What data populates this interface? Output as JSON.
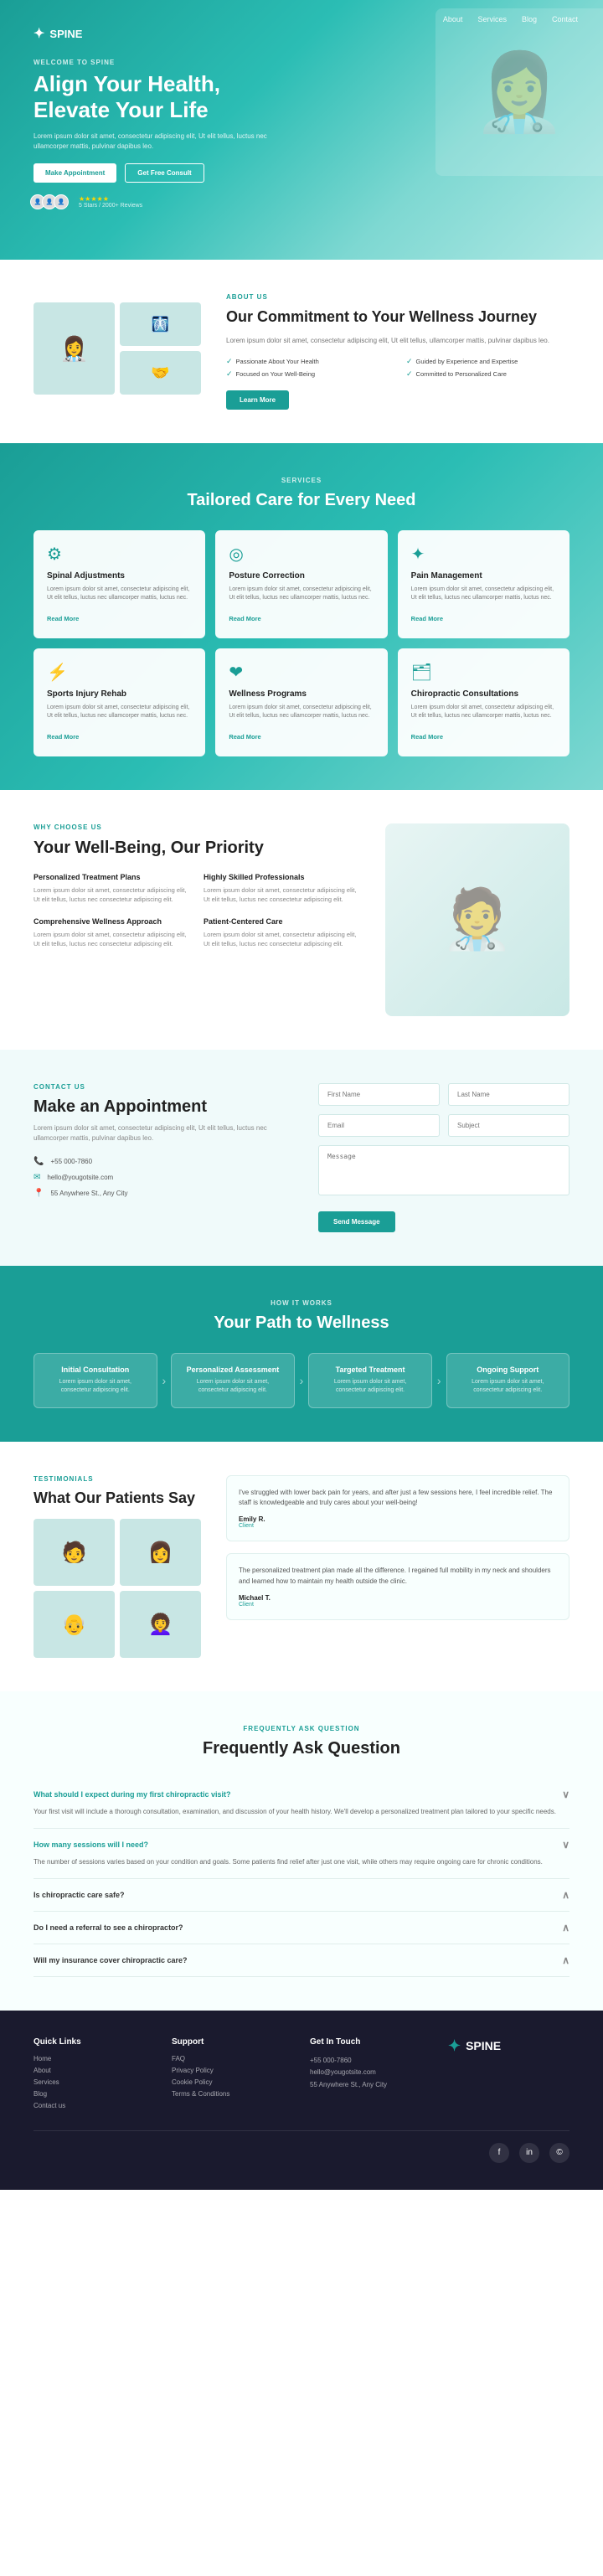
{
  "brand": {
    "name": "SPINE",
    "logo_symbol": "✦"
  },
  "nav": {
    "items": [
      "About",
      "Services",
      "Blog",
      "Contact"
    ]
  },
  "hero": {
    "welcome": "WELCOME TO SPINE",
    "headline": "Align Your Health, Elevate Your Life",
    "description": "Lorem ipsum dolor sit amet, consectetur adipiscing elit, Ut elit tellus, luctus nec ullamcorper mattis, pulvinar dapibus leo.",
    "btn_appointment": "Make Appointment",
    "btn_consult": "Get Free Consult",
    "rating": "★★★★★",
    "rating_text": "5 Stars / 2000+ Reviews"
  },
  "commitment": {
    "label": "ABOUT US",
    "heading": "Our Commitment to Your Wellness Journey",
    "description": "Lorem ipsum dolor sit amet, consectetur adipiscing elit, Ut elit tellus, ullamcorper mattis, pulvinar dapibus leo.",
    "features": [
      "Passionate About Your Health",
      "Guided by Experience and Expertise",
      "Focused on Your Well-Being",
      "Committed to Personalized Care"
    ],
    "btn_learn": "Learn More"
  },
  "services": {
    "label": "SERVICES",
    "heading": "Tailored Care for Every Need",
    "items": [
      {
        "icon": "⚙",
        "title": "Spinal Adjustments",
        "description": "Lorem ipsum dolor sit amet, consectetur adipiscing elit, Ut elit tellus, luctus nec ullamcorper mattis, luctus nec.",
        "link": "Read More"
      },
      {
        "icon": "◎",
        "title": "Posture Correction",
        "description": "Lorem ipsum dolor sit amet, consectetur adipiscing elit, Ut elit tellus, luctus nec ullamcorper mattis, luctus nec.",
        "link": "Read More"
      },
      {
        "icon": "✦",
        "title": "Pain Management",
        "description": "Lorem ipsum dolor sit amet, consectetur adipiscing elit, Ut elit tellus, luctus nec ullamcorper mattis, luctus nec.",
        "link": "Read More"
      },
      {
        "icon": "⚡",
        "title": "Sports Injury Rehab",
        "description": "Lorem ipsum dolor sit amet, consectetur adipiscing elit, Ut elit tellus, luctus nec ullamcorper mattis, luctus nec.",
        "link": "Read More"
      },
      {
        "icon": "❤",
        "title": "Wellness Programs",
        "description": "Lorem ipsum dolor sit amet, consectetur adipiscing elit, Ut elit tellus, luctus nec ullamcorper mattis, luctus nec.",
        "link": "Read More"
      },
      {
        "icon": "🗂",
        "title": "Chiropractic Consultations",
        "description": "Lorem ipsum dolor sit amet, consectetur adipiscing elit, Ut elit tellus, luctus nec ullamcorper mattis, luctus nec.",
        "link": "Read More"
      }
    ]
  },
  "why": {
    "label": "WHY CHOOSE US",
    "heading": "Your Well-Being, Our Priority",
    "items": [
      {
        "title": "Personalized Treatment Plans",
        "description": "Lorem ipsum dolor sit amet, consectetur adipiscing elit, Ut elit tellus, luctus nec consectetur adipiscing elit."
      },
      {
        "title": "Highly Skilled Professionals",
        "description": "Lorem ipsum dolor sit amet, consectetur adipiscing elit, Ut elit tellus, luctus nec consectetur adipiscing elit."
      },
      {
        "title": "Comprehensive Wellness Approach",
        "description": "Lorem ipsum dolor sit amet, consectetur adipiscing elit, Ut elit tellus, luctus nec consectetur adipiscing elit."
      },
      {
        "title": "Patient-Centered Care",
        "description": "Lorem ipsum dolor sit amet, consectetur adipiscing elit, Ut elit tellus, luctus nec consectetur adipiscing elit."
      }
    ]
  },
  "appointment": {
    "label": "CONTACT US",
    "heading": "Make an Appointment",
    "description": "Lorem ipsum dolor sit amet, consectetur adipiscing elit, Ut elit tellus, luctus nec ullamcorper mattis, pulvinar dapibus leo.",
    "phone": "+55 000-7860",
    "email": "hello@yougotsite.com",
    "address": "55 Anywhere St., Any City",
    "form": {
      "first_name_placeholder": "First Name",
      "last_name_placeholder": "Last Name",
      "email_placeholder": "Email",
      "subject_placeholder": "Subject",
      "message_placeholder": "Message",
      "btn_send": "Send Message"
    }
  },
  "path": {
    "label": "HOW IT WORKS",
    "heading": "Your Path to Wellness",
    "steps": [
      {
        "title": "Initial Consultation",
        "description": "Lorem ipsum dolor sit amet, consectetur adipiscing elit."
      },
      {
        "title": "Personalized Assessment",
        "description": "Lorem ipsum dolor sit amet, consectetur adipiscing elit."
      },
      {
        "title": "Targeted Treatment",
        "description": "Lorem ipsum dolor sit amet, consectetur adipiscing elit."
      },
      {
        "title": "Ongoing Support",
        "description": "Lorem ipsum dolor sit amet, consectetur adipiscing elit."
      }
    ]
  },
  "testimonials": {
    "label": "TESTIMONIALS",
    "heading": "What Our Patients Say",
    "items": [
      {
        "text": "I've struggled with lower back pain for years, and after just a few sessions here, I feel incredible relief. The staff is knowledgeable and truly cares about your well-being!",
        "author": "Emily R.",
        "role": "Client"
      },
      {
        "text": "The personalized treatment plan made all the difference. I regained full mobility in my neck and shoulders and learned how to maintain my health outside the clinic.",
        "author": "Michael T.",
        "role": "Client"
      }
    ]
  },
  "faq": {
    "label": "FREQUENTLY ASK QUESTION",
    "heading": "Frequently Ask Question",
    "items": [
      {
        "question": "What should I expect during my first chiropractic visit?",
        "answer": "Your first visit will include a thorough consultation, examination, and discussion of your health history. We'll develop a personalized treatment plan tailored to your specific needs.",
        "open": true
      },
      {
        "question": "How many sessions will I need?",
        "answer": "The number of sessions varies based on your condition and goals. Some patients find relief after just one visit, while others may require ongoing care for chronic conditions.",
        "open": true
      },
      {
        "question": "Is chiropractic care safe?",
        "answer": "",
        "open": false
      },
      {
        "question": "Do I need a referral to see a chiropractor?",
        "answer": "",
        "open": false
      },
      {
        "question": "Will my insurance cover chiropractic care?",
        "answer": "",
        "open": false
      }
    ]
  },
  "footer": {
    "quick_links": {
      "heading": "Quick Links",
      "items": [
        "Home",
        "About",
        "Services",
        "Blog",
        "Contact us"
      ]
    },
    "support": {
      "heading": "Support",
      "items": [
        "FAQ",
        "Privacy Policy",
        "Cookie Policy",
        "Terms & Conditions"
      ]
    },
    "contact": {
      "heading": "Get In Touch",
      "phone": "+55 000-7860",
      "email": "hello@yougotsite.com",
      "address": "55 Anywhere St., Any City"
    },
    "social": [
      "f",
      "in",
      "©"
    ]
  }
}
